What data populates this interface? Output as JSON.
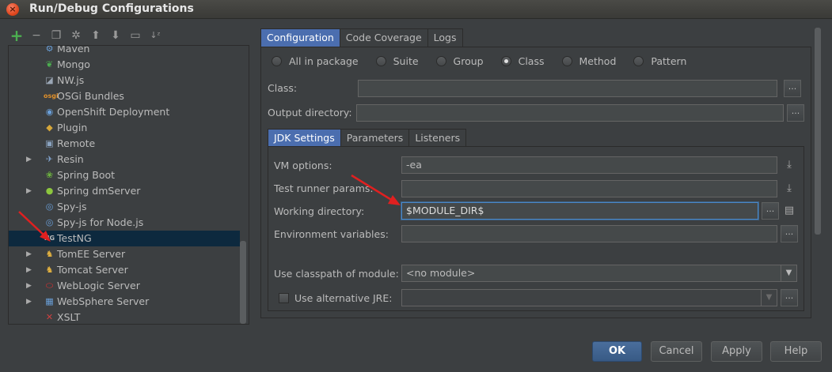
{
  "window": {
    "title": "Run/Debug Configurations",
    "close_glyph": "×"
  },
  "toolbar": {
    "icons": [
      "add-icon",
      "remove-icon",
      "copy-icon",
      "edit-defaults-icon",
      "move-up-icon",
      "move-down-icon",
      "folder-icon",
      "sort-icon"
    ],
    "glyphs": [
      "+",
      "−",
      "❐",
      "✲",
      "⬆",
      "⬇",
      "▭",
      "↓ᶻ"
    ]
  },
  "tree": {
    "items": [
      {
        "label": "Maven",
        "icon": "maven-icon",
        "glyph": "⚙",
        "color": "#6a9fd8",
        "expandable": false
      },
      {
        "label": "Mongo",
        "icon": "mongo-icon",
        "glyph": "❦",
        "color": "#4caf50",
        "expandable": false
      },
      {
        "label": "NW.js",
        "icon": "nwjs-icon",
        "glyph": "◪",
        "color": "#9aa6b5",
        "expandable": false
      },
      {
        "label": "OSGi Bundles",
        "icon": "osgi-icon",
        "glyph": "osgi",
        "color": "#e0902a",
        "expandable": false
      },
      {
        "label": "OpenShift Deployment",
        "icon": "openshift-icon",
        "glyph": "◉",
        "color": "#6a9fd8",
        "expandable": false
      },
      {
        "label": "Plugin",
        "icon": "plugin-icon",
        "glyph": "◆",
        "color": "#d6a73a",
        "expandable": false
      },
      {
        "label": "Remote",
        "icon": "remote-icon",
        "glyph": "▣",
        "color": "#8aa3c0",
        "expandable": false
      },
      {
        "label": "Resin",
        "icon": "resin-icon",
        "glyph": "✈",
        "color": "#7fa0c8",
        "expandable": true
      },
      {
        "label": "Spring Boot",
        "icon": "spring-boot-icon",
        "glyph": "❀",
        "color": "#6db33f",
        "expandable": false
      },
      {
        "label": "Spring dmServer",
        "icon": "spring-dmserver-icon",
        "glyph": "●",
        "color": "#8cc63e",
        "expandable": true
      },
      {
        "label": "Spy-js",
        "icon": "spyjs-icon",
        "glyph": "◎",
        "color": "#6a9fd8",
        "expandable": false
      },
      {
        "label": "Spy-js for Node.js",
        "icon": "spyjs-node-icon",
        "glyph": "◎",
        "color": "#6a9fd8",
        "expandable": false
      },
      {
        "label": "TestNG",
        "icon": "testng-icon",
        "glyph": "NG",
        "color": "#bbbbbb",
        "expandable": false,
        "selected": true
      },
      {
        "label": "TomEE Server",
        "icon": "tomee-icon",
        "glyph": "♞",
        "color": "#e0b040",
        "expandable": true
      },
      {
        "label": "Tomcat Server",
        "icon": "tomcat-icon",
        "glyph": "♞",
        "color": "#e0b040",
        "expandable": true
      },
      {
        "label": "WebLogic Server",
        "icon": "weblogic-icon",
        "glyph": "⬭",
        "color": "#e03030",
        "expandable": true
      },
      {
        "label": "WebSphere Server",
        "icon": "websphere-icon",
        "glyph": "▦",
        "color": "#6a9fd8",
        "expandable": true
      },
      {
        "label": "XSLT",
        "icon": "xslt-icon",
        "glyph": "✕",
        "color": "#d04040",
        "expandable": false
      }
    ]
  },
  "main_tabs": [
    {
      "label": "Configuration",
      "active": true
    },
    {
      "label": "Code Coverage",
      "active": false
    },
    {
      "label": "Logs",
      "active": false
    }
  ],
  "test_kind": {
    "options": [
      "All in package",
      "Suite",
      "Group",
      "Class",
      "Method",
      "Pattern"
    ],
    "selected": "Class"
  },
  "fields": {
    "class_label": "Class:",
    "class_value": "",
    "output_dir_label": "Output directory:",
    "output_dir_value": ""
  },
  "inner_tabs": [
    {
      "label": "JDK Settings",
      "active": true
    },
    {
      "label": "Parameters",
      "active": false
    },
    {
      "label": "Listeners",
      "active": false
    }
  ],
  "jdk": {
    "vm_options_label": "VM options:",
    "vm_options_value": "-ea",
    "test_runner_label": "Test runner params:",
    "test_runner_value": "",
    "working_dir_label": "Working directory:",
    "working_dir_value": "$MODULE_DIR$",
    "env_vars_label": "Environment variables:",
    "env_vars_value": "",
    "classpath_label": "Use classpath of module:",
    "classpath_value": "<no module>",
    "alt_jre_label": "Use alternative JRE:",
    "alt_jre_value": "",
    "alt_jre_checked": false
  },
  "glyphs": {
    "ellipsis": "...",
    "expand": "⤓",
    "doc": "▤",
    "dropdown": "▼",
    "tree_arrow": "▶"
  },
  "buttons": {
    "ok": "OK",
    "cancel": "Cancel",
    "apply": "Apply",
    "help": "Help"
  },
  "accent": {
    "selection": "#0d293e",
    "tab_active": "#4b6eaf",
    "annotation_arrow": "#e02020"
  }
}
